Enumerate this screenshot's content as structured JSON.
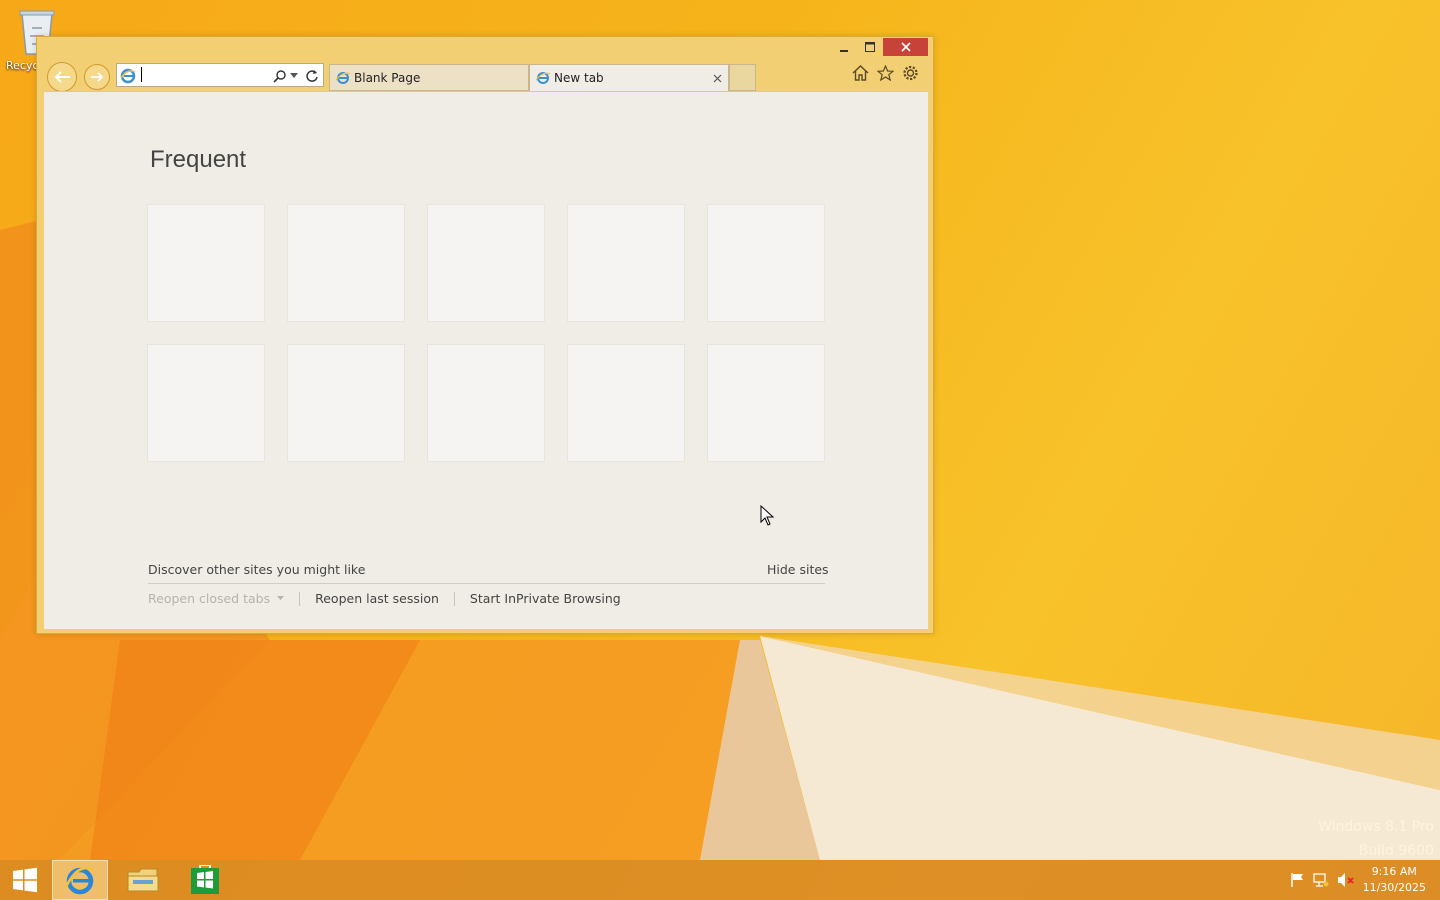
{
  "desktop": {
    "recycle_bin_label": "Recyc",
    "watermark_line1": "Windows 8.1 Pro",
    "watermark_line2": "Build 9600"
  },
  "browser": {
    "address_value": "",
    "tabs": [
      {
        "label": "Blank Page",
        "active": false
      },
      {
        "label": "New tab",
        "active": true
      }
    ],
    "frequent_title": "Frequent",
    "tile_count": 10,
    "discover_text": "Discover other sites you might like",
    "hide_sites": "Hide sites",
    "reopen_closed_tabs": "Reopen closed tabs",
    "reopen_last_session": "Reopen last session",
    "start_inprivate": "Start InPrivate Browsing"
  },
  "taskbar": {
    "time": "9:16 AM",
    "date": "11/30/2025"
  },
  "colors": {
    "accent_close": "#c7433a",
    "desktop_bg": "#f6b41a",
    "window_frame": "#f3cf74"
  }
}
